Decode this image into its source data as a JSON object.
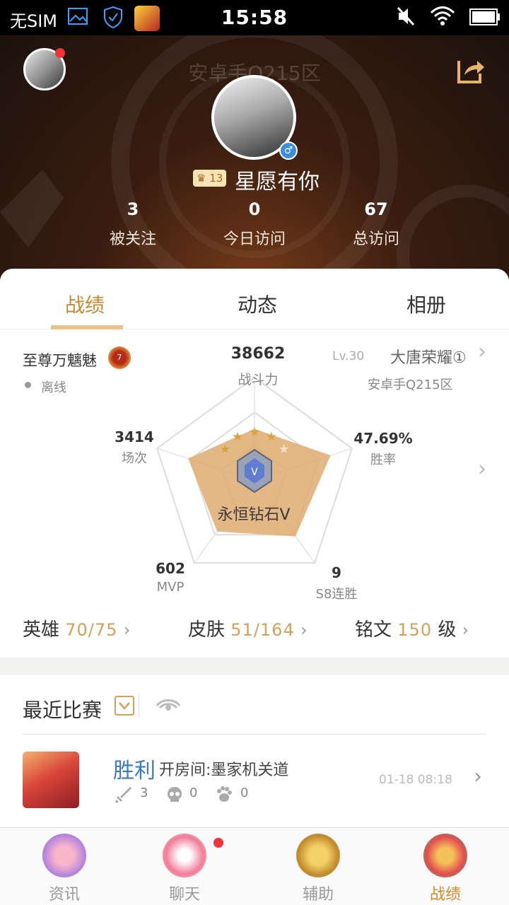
{
  "status_bar": {
    "carrier": "无SIM",
    "time": "15:58",
    "icons": [
      "image-icon",
      "shield-icon",
      "game-app-icon",
      "mute-icon",
      "wifi-icon",
      "battery-icon"
    ]
  },
  "profile": {
    "server_bg": "安卓手Q215区",
    "level": "13",
    "nickname": "星愿有你",
    "gender_icon": "male-icon",
    "stats": [
      {
        "value": "3",
        "label": "被关注"
      },
      {
        "value": "0",
        "label": "今日访问"
      },
      {
        "value": "67",
        "label": "总访问"
      }
    ]
  },
  "tabs": [
    {
      "label": "战绩",
      "active": true
    },
    {
      "label": "动态",
      "active": false
    },
    {
      "label": "相册",
      "active": false
    }
  ],
  "record": {
    "rank_title": "至尊万魑魅",
    "rank_badge": "7",
    "online_status": "离线",
    "power_value": "38662",
    "power_label": "战斗力",
    "account_level": "Lv.30",
    "server_name": "大唐荣耀①",
    "server_zone": "安卓手Q215区",
    "win_rate": "47.69%",
    "win_rate_label": "胜率",
    "matches": "3414",
    "matches_label": "场次",
    "mvp": "602",
    "mvp_label": "MVP",
    "win_streak": "9",
    "win_streak_label": "S8连胜",
    "tier": "永恒钻石V",
    "tier_stars_filled": 4,
    "tier_stars_total": 5,
    "radar_levels": [
      0.5,
      0.78,
      0.68,
      0.62,
      0.68
    ],
    "colors": {
      "accent": "#d4a05a",
      "radar_fill": "#deab70"
    }
  },
  "inventory": {
    "heroes_label": "英雄",
    "heroes_count": "70/75",
    "skins_label": "皮肤",
    "skins_count": "51/164",
    "runes_label": "铭文",
    "runes_count": "150",
    "runes_unit": "级"
  },
  "recent": {
    "title": "最近比赛",
    "match": {
      "result": "胜利",
      "mode": "开房间:墨家机关道",
      "kills": "3",
      "deaths": "0",
      "assists": "0",
      "time": "01-18 08:18"
    }
  },
  "bottom_nav": [
    {
      "label": "资讯",
      "active": false
    },
    {
      "label": "聊天",
      "active": false
    },
    {
      "label": "辅助",
      "active": false
    },
    {
      "label": "战绩",
      "active": true
    }
  ]
}
